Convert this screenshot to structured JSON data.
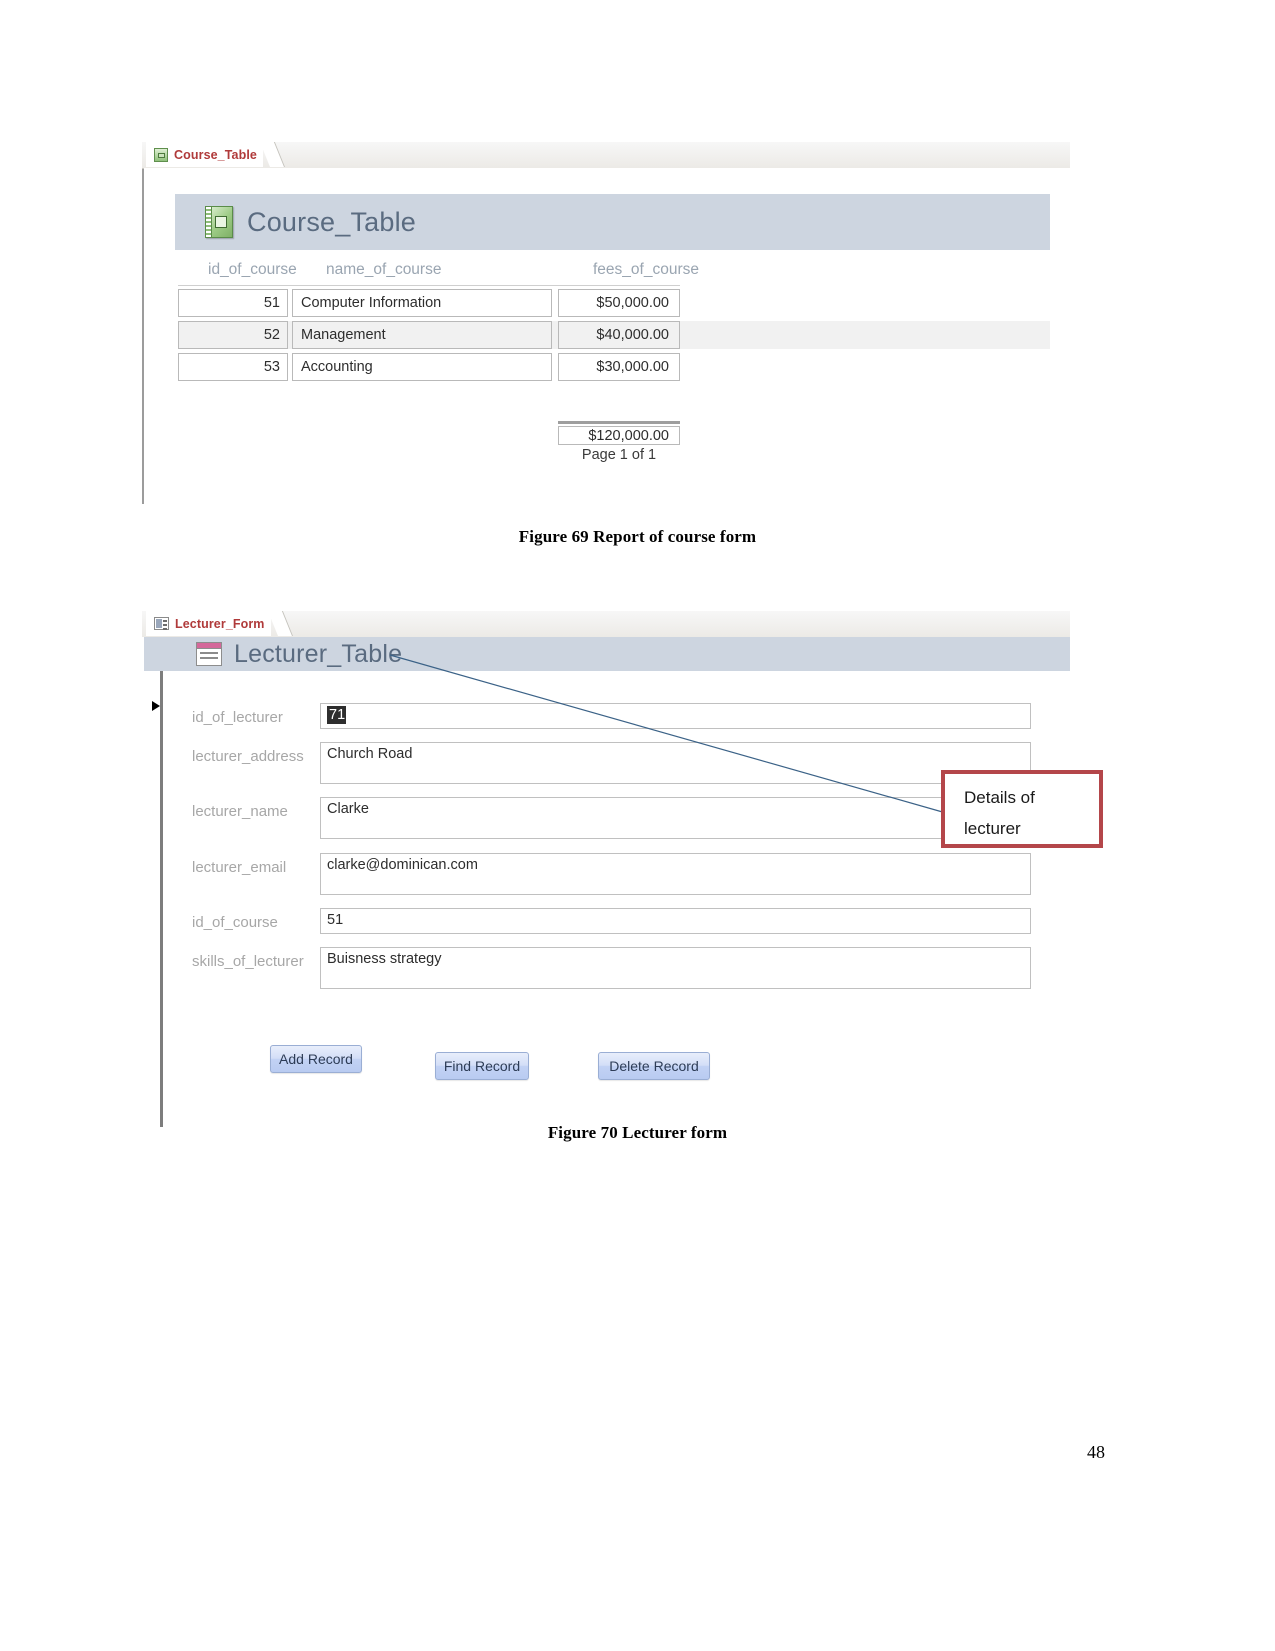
{
  "page": {
    "number": "48"
  },
  "figure69": {
    "caption": "Figure 69 Report of course form",
    "tab": {
      "label": "Course_Table",
      "icon": "table-icon"
    },
    "report": {
      "title": "Course_Table",
      "columns": [
        "id_of_course",
        "name_of_course",
        "fees_of_course"
      ],
      "rows": [
        {
          "id_of_course": "51",
          "name_of_course": "Computer Information",
          "fees_of_course": "$50,000.00"
        },
        {
          "id_of_course": "52",
          "name_of_course": "Management",
          "fees_of_course": "$40,000.00"
        },
        {
          "id_of_course": "53",
          "name_of_course": "Accounting",
          "fees_of_course": "$30,000.00"
        }
      ],
      "total": "$120,000.00",
      "page_footer": "Page 1 of 1"
    }
  },
  "figure70": {
    "caption": "Figure 70 Lecturer form",
    "tab": {
      "label": "Lecturer_Form",
      "icon": "form-icon"
    },
    "form": {
      "title": "Lecturer_Table",
      "fields": [
        {
          "label": "id_of_lecturer",
          "value": "71",
          "selected": true
        },
        {
          "label": "lecturer_address",
          "value": "Church Road",
          "selected": false
        },
        {
          "label": "lecturer_name",
          "value": "Clarke",
          "selected": false
        },
        {
          "label": "lecturer_email",
          "value": "clarke@dominican.com",
          "selected": false
        },
        {
          "label": "id_of_course",
          "value": "51",
          "selected": false
        },
        {
          "label": "skills_of_lecturer",
          "value": "Buisness strategy",
          "selected": false
        }
      ],
      "buttons": [
        {
          "label": "Add Record"
        },
        {
          "label": "Find Record"
        },
        {
          "label": "Delete Record"
        }
      ]
    },
    "annotation": {
      "line1": "Details of",
      "line2": "lecturer",
      "border_color": "#b4464a",
      "leader_color": "#3b6287"
    }
  }
}
